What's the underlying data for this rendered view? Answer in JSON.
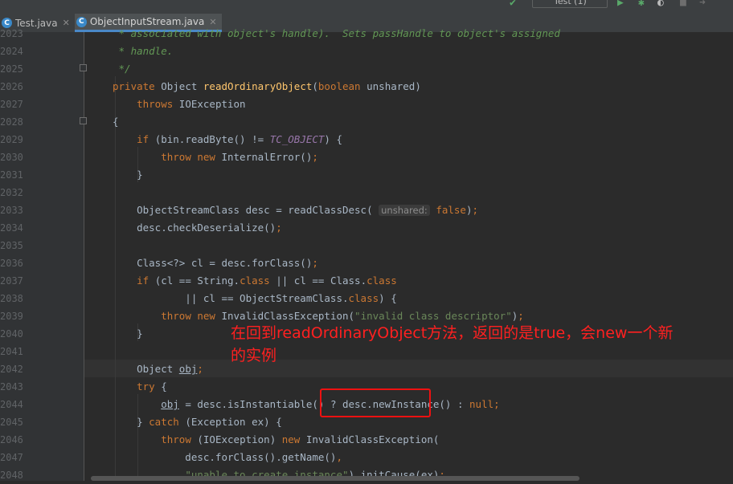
{
  "tabs": [
    {
      "label": "Test.java",
      "active": false
    },
    {
      "label": "ObjectInputStream.java",
      "active": true
    }
  ],
  "toolbar": {
    "run_config": "Test (1)"
  },
  "lines": [
    {
      "n": "2023",
      "html": "<span class='cm'> * associated with object's handle).  Sets passHandle to object's assigned</span>"
    },
    {
      "n": "2024",
      "html": "<span class='cm'> * handle.</span>"
    },
    {
      "n": "2025",
      "html": "<span class='cm'> */</span>"
    },
    {
      "n": "2026",
      "html": "<span class='kw'>private</span> Object <span class='fn'>readOrdinaryObject</span>(<span class='kw'>boolean</span> unshared)"
    },
    {
      "n": "2027",
      "html": "    <span class='kw'>throws</span> IOException"
    },
    {
      "n": "2028",
      "html": "{"
    },
    {
      "n": "2029",
      "html": "    <span class='kw'>if</span> (bin.readByte() != <span class='cst'>TC_OBJECT</span>) {"
    },
    {
      "n": "2030",
      "html": "        <span class='kw'>throw new</span> InternalError()<span class='kw'>;</span>"
    },
    {
      "n": "2031",
      "html": "    }"
    },
    {
      "n": "2032",
      "html": ""
    },
    {
      "n": "2033",
      "html": "    ObjectStreamClass desc = readClassDesc( <span class='hint'>unshared:</span> <span class='kw'>false</span>)<span class='kw'>;</span>"
    },
    {
      "n": "2034",
      "html": "    desc.checkDeserialize()<span class='kw'>;</span>"
    },
    {
      "n": "2035",
      "html": ""
    },
    {
      "n": "2036",
      "html": "    Class&lt;?&gt; cl = desc.forClass()<span class='kw'>;</span>"
    },
    {
      "n": "2037",
      "html": "    <span class='kw'>if</span> (cl == String.<span class='kw'>class</span> || cl == Class.<span class='kw'>class</span>"
    },
    {
      "n": "2038",
      "html": "            || cl == ObjectStreamClass.<span class='kw'>class</span>) {"
    },
    {
      "n": "2039",
      "html": "        <span class='kw'>throw new</span> InvalidClassException(<span class='str'>\"invalid class descriptor\"</span>)<span class='kw'>;</span>"
    },
    {
      "n": "2040",
      "html": "    }"
    },
    {
      "n": "2041",
      "html": ""
    },
    {
      "n": "2042",
      "html": "    Object <span class='ul'>obj</span><span class='kw'>;</span>"
    },
    {
      "n": "2043",
      "html": "    <span class='kw'>try</span> {"
    },
    {
      "n": "2044",
      "html": "        <span class='ul'>obj</span> = desc.isInstantiable() ? desc.newInstance() : <span class='kw'>null;</span>"
    },
    {
      "n": "2045",
      "html": "    } <span class='kw'>catch</span> (Exception ex) {"
    },
    {
      "n": "2046",
      "html": "        <span class='kw'>throw</span> (IOException) <span class='kw'>new</span> InvalidClassException("
    },
    {
      "n": "2047",
      "html": "            desc.forClass().getName()<span class='kw'>,</span>"
    },
    {
      "n": "2048",
      "html": "            <span class='str'>\"unable to create instance\"</span>).initCause(ex)<span class='kw'>;</span>"
    }
  ],
  "annotation": "在回到readOrdinaryObject方法，返回的是true，会new一个新的实例"
}
